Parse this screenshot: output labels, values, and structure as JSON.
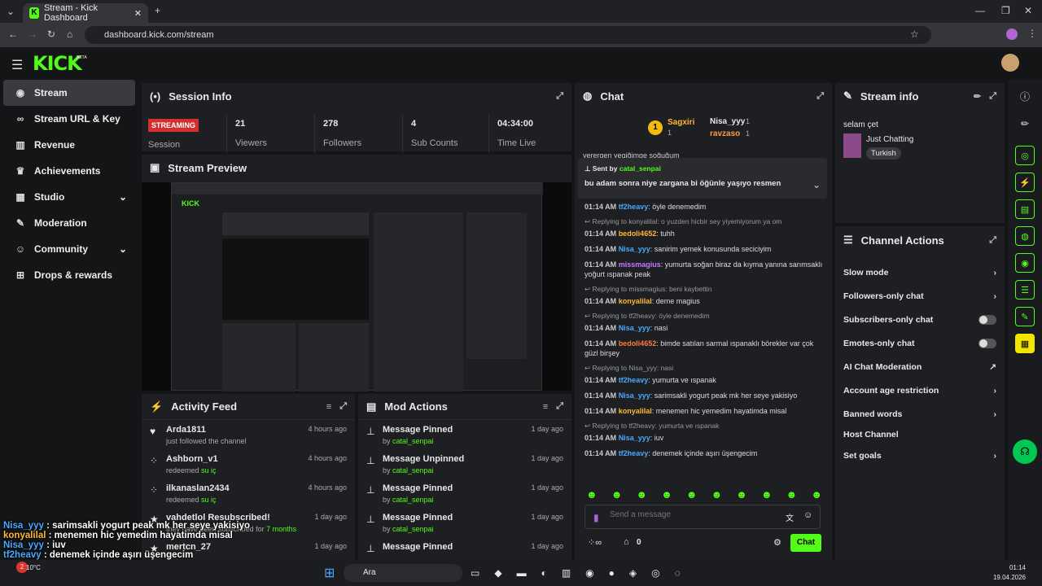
{
  "browser": {
    "tab_title": "Stream - Kick Dashboard",
    "url": "dashboard.kick.com/stream"
  },
  "brand": {
    "logo": "KICK",
    "beta": "BETA",
    "accent": "#53fc18"
  },
  "sidebar": {
    "items": [
      {
        "label": "Stream",
        "icon": "broadcast-icon"
      },
      {
        "label": "Stream URL & Key",
        "icon": "link-icon"
      },
      {
        "label": "Revenue",
        "icon": "chart-icon"
      },
      {
        "label": "Achievements",
        "icon": "trophy-icon"
      },
      {
        "label": "Studio",
        "icon": "grid-icon"
      },
      {
        "label": "Moderation",
        "icon": "wrench-icon"
      },
      {
        "label": "Community",
        "icon": "people-icon"
      },
      {
        "label": "Drops & rewards",
        "icon": "gift-icon"
      }
    ]
  },
  "session": {
    "title": "Session Info",
    "badge": "STREAMING",
    "session_label": "Session",
    "stats": [
      {
        "value": "21",
        "label": "Viewers"
      },
      {
        "value": "278",
        "label": "Followers"
      },
      {
        "value": "4",
        "label": "Sub Counts"
      },
      {
        "value": "04:34:00",
        "label": "Time Live"
      }
    ]
  },
  "preview": {
    "title": "Stream Preview"
  },
  "activity": {
    "title": "Activity Feed",
    "rows": [
      {
        "name": "Arda1811",
        "sub": "just followed the channel",
        "sub_hl": "",
        "time": "4 hours ago"
      },
      {
        "name": "Ashborn_v1",
        "sub": "redeemed ",
        "sub_hl": "su iç",
        "time": "4 hours ago"
      },
      {
        "name": "ilkanaslan2434",
        "sub": "redeemed ",
        "sub_hl": "su iç",
        "time": "4 hours ago"
      },
      {
        "name": "vahdetlol Resubscribed!",
        "sub": "they have been subscribed for ",
        "sub_hl": "7 months",
        "time": "1 day ago"
      },
      {
        "name": "mertcn_27",
        "sub": "",
        "sub_hl": "",
        "time": "1 day ago"
      }
    ]
  },
  "mod": {
    "title": "Mod Actions",
    "rows": [
      {
        "name": "Message Pinned",
        "by": "by ",
        "who": "catal_senpai",
        "time": "1 day ago"
      },
      {
        "name": "Message Unpinned",
        "by": "by ",
        "who": "catal_senpai",
        "time": "1 day ago"
      },
      {
        "name": "Message Pinned",
        "by": "by ",
        "who": "catal_senpai",
        "time": "1 day ago"
      },
      {
        "name": "Message Pinned",
        "by": "by ",
        "who": "catal_senpai",
        "time": "1 day ago"
      },
      {
        "name": "Message Pinned",
        "by": "",
        "who": "",
        "time": "1 day ago"
      }
    ]
  },
  "chat": {
    "title": "Chat",
    "top_gifters": [
      {
        "name": "Sagxiri",
        "count": "1"
      },
      {
        "name": "Nisa_yyy",
        "count": "1"
      },
      {
        "name": "ravzaso",
        "count": "1"
      }
    ],
    "cut_line": "yerergen yegiğimge soğuğum",
    "pinned": {
      "sent_by": "Sent by",
      "user": "catal_senpai",
      "text": "bu adam sonra niye zargana bi öğünle yaşıyo resmen"
    },
    "messages": [
      {
        "reply": "",
        "time": "01:14 AM",
        "user": "tf2heavy",
        "color": "#4aa8ff",
        "text": "öyle denemedim"
      },
      {
        "reply": "Replying to konyalilal: o yuzden hicbir sey yiyemiyorum ya om",
        "time": "01:14 AM",
        "user": "bedoli4652",
        "color": "#ffb833",
        "text": "tuhh"
      },
      {
        "reply": "",
        "time": "01:14 AM",
        "user": "Nisa_yyy",
        "color": "#4aa8ff",
        "text": "sanirim yemek konusunda seciciyim"
      },
      {
        "reply": "",
        "time": "01:14 AM",
        "user": "missmagius",
        "color": "#c678ff",
        "text": "yumurta soğan biraz da kıyma yanına sarımsaklı yoğurt ıspanak peak"
      },
      {
        "reply": "Replying to missmagius: beni kaybettin",
        "time": "01:14 AM",
        "user": "konyalilal",
        "color": "#ffb833",
        "text": "deme magius"
      },
      {
        "reply": "Replying to tf2heavy: öyle denemedim",
        "time": "01:14 AM",
        "user": "Nisa_yyy",
        "color": "#4aa8ff",
        "text": "nasi"
      },
      {
        "reply": "",
        "time": "01:14 AM",
        "user": "bedoli4652",
        "color": "#ff7a3d",
        "text": "bimde satılan sarmal ıspanaklı börekler var çok güzl birşey"
      },
      {
        "reply": "Replying to Nisa_yyy: nasi",
        "time": "01:14 AM",
        "user": "tf2heavy",
        "color": "#4aa8ff",
        "text": "yumurta ve ıspanak"
      },
      {
        "reply": "",
        "time": "01:14 AM",
        "user": "Nisa_yyy",
        "color": "#4aa8ff",
        "text": "sarimsakli yogurt peak mk her seye yakisiyo"
      },
      {
        "reply": "",
        "time": "01:14 AM",
        "user": "konyalilal",
        "color": "#ffb833",
        "text": "menemen hic yemedim hayatimda misal"
      },
      {
        "reply": "Replying to tf2heavy: yumurta ve ıspanak",
        "time": "01:14 AM",
        "user": "Nisa_yyy",
        "color": "#4aa8ff",
        "text": "iuv"
      },
      {
        "reply": "",
        "time": "01:14 AM",
        "user": "tf2heavy",
        "color": "#4aa8ff",
        "text": "denemek içinde aşırı üşengecim"
      }
    ],
    "input_placeholder": "Send a message",
    "points": "0",
    "send": "Chat"
  },
  "stream_info": {
    "title": "Stream info",
    "stream_title": "selam çet",
    "category": "Just Chatting",
    "tag": "Turkish"
  },
  "channel_actions": {
    "title": "Channel Actions",
    "items": [
      {
        "label": "Slow mode",
        "ctrl": "chevron"
      },
      {
        "label": "Followers-only chat",
        "ctrl": "chevron"
      },
      {
        "label": "Subscribers-only chat",
        "ctrl": "toggle"
      },
      {
        "label": "Emotes-only chat",
        "ctrl": "toggle"
      },
      {
        "label": "AI Chat Moderation",
        "ctrl": "external"
      },
      {
        "label": "Account age restriction",
        "ctrl": "chevron"
      },
      {
        "label": "Banned words",
        "ctrl": "chevron"
      },
      {
        "label": "Host Channel",
        "ctrl": "none"
      },
      {
        "label": "Set goals",
        "ctrl": "chevron"
      }
    ]
  },
  "overlay": [
    {
      "user": "Nisa_yyy",
      "text": " : sarimsakli yogurt peak mk her seye yakisiyo"
    },
    {
      "user": "konyalilal",
      "text": " : menemen hic yemedim hayatimda misal"
    },
    {
      "user": "Nisa_yyy",
      "text": " : iuv"
    },
    {
      "user": "tf2heavy",
      "text": " : denemek içinde aşırı üşengecim"
    }
  ],
  "taskbar": {
    "search": "Ara",
    "weather": "10°C",
    "time": "01:14",
    "date": "19.04.2026"
  }
}
